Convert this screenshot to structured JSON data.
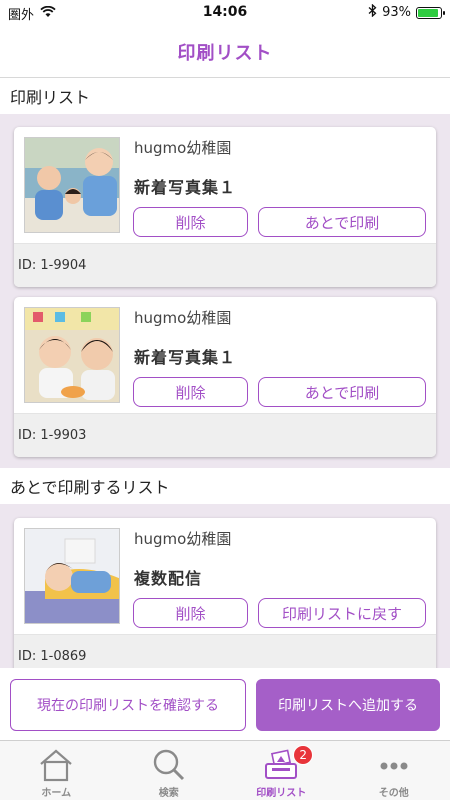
{
  "status_bar": {
    "carrier": "圏外",
    "time": "14:06",
    "battery_percent": "93%",
    "battery_level": 0.93
  },
  "nav": {
    "title": "印刷リスト"
  },
  "sections": {
    "print_list": "印刷リスト",
    "later_list": "あとで印刷するリスト"
  },
  "print_list_items": [
    {
      "school": "hugmo幼稚園",
      "title": "新着写真集１",
      "delete_label": "削除",
      "later_label": "あとで印刷",
      "id": "ID: 1-9904",
      "photo_icon": "kids-classroom-photo"
    },
    {
      "school": "hugmo幼稚園",
      "title": "新着写真集１",
      "delete_label": "削除",
      "later_label": "あとで印刷",
      "id": "ID: 1-9903",
      "photo_icon": "kids-lunch-photo"
    }
  ],
  "later_list_items": [
    {
      "school": "hugmo幼稚園",
      "title": "複数配信",
      "delete_label": "削除",
      "return_label": "印刷リストに戻す",
      "id": "ID: 1-0869",
      "photo_icon": "child-sleeping-photo"
    }
  ],
  "actions": {
    "confirm_label": "現在の印刷リストを確認する",
    "add_label": "印刷リストへ追加する"
  },
  "tabs": [
    {
      "label": "ホーム",
      "icon": "home-icon"
    },
    {
      "label": "検索",
      "icon": "search-icon"
    },
    {
      "label": "印刷リスト",
      "icon": "print-list-icon",
      "badge": "2",
      "active": true
    },
    {
      "label": "その他",
      "icon": "more-icon"
    }
  ],
  "colors": {
    "accent": "#a24fc6",
    "accent_fill": "#a55fc8",
    "background": "#ede6ef",
    "badge": "#e8343a"
  }
}
